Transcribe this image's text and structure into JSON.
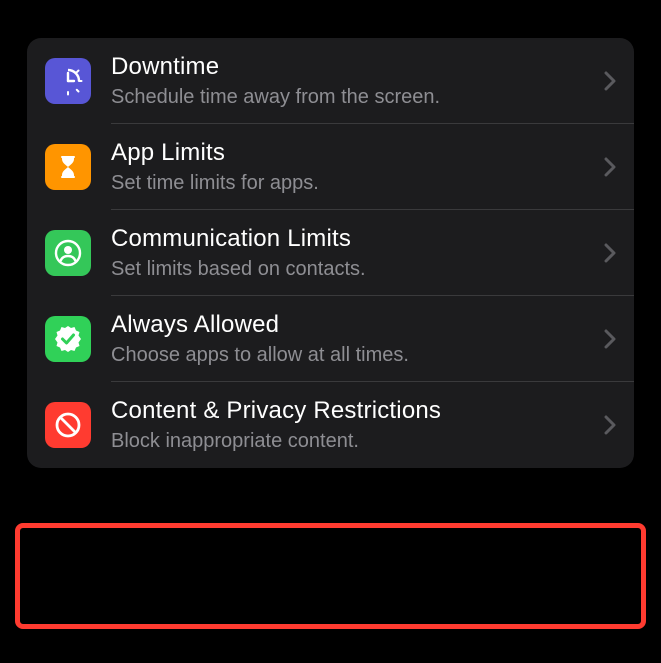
{
  "settings": {
    "items": [
      {
        "title": "Downtime",
        "subtitle": "Schedule time away from the screen."
      },
      {
        "title": "App Limits",
        "subtitle": "Set time limits for apps."
      },
      {
        "title": "Communication Limits",
        "subtitle": "Set limits based on contacts."
      },
      {
        "title": "Always Allowed",
        "subtitle": "Choose apps to allow at all times."
      },
      {
        "title": "Content & Privacy Restrictions",
        "subtitle": "Block inappropriate content."
      }
    ]
  },
  "highlight_index": 4,
  "colors": {
    "highlight": "#ff3b30"
  }
}
